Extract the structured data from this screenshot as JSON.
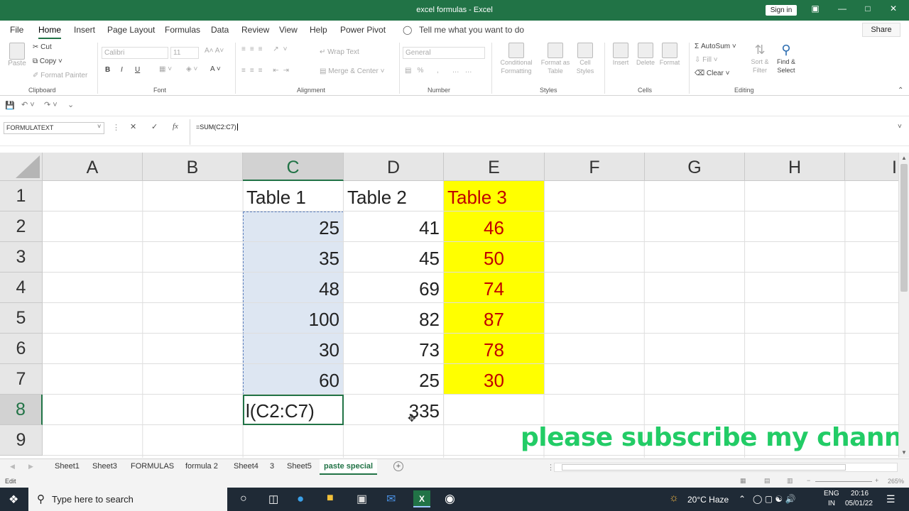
{
  "window": {
    "title": "excel formulas  -  Excel",
    "signin": "Sign in"
  },
  "tabs": [
    "File",
    "Home",
    "Insert",
    "Page Layout",
    "Formulas",
    "Data",
    "Review",
    "View",
    "Help",
    "Power Pivot"
  ],
  "tell_me": "Tell me what you want to do",
  "share": "Share",
  "ribbon": {
    "clipboard": {
      "label": "Clipboard",
      "paste": "Paste",
      "cut": "Cut",
      "copy": "Copy",
      "painter": "Format Painter"
    },
    "font": {
      "label": "Font",
      "name": "Calibri",
      "size": "11"
    },
    "alignment": {
      "label": "Alignment",
      "wrap": "Wrap Text",
      "merge": "Merge & Center"
    },
    "number": {
      "label": "Number",
      "format": "General"
    },
    "styles": {
      "label": "Styles",
      "cond": "Conditional Formatting",
      "table": "Format as Table",
      "cellstyles": "Cell Styles"
    },
    "cells": {
      "label": "Cells",
      "insert": "Insert",
      "delete": "Delete",
      "format": "Format"
    },
    "editing": {
      "label": "Editing",
      "autosum": "AutoSum",
      "fill": "Fill",
      "clear": "Clear",
      "sort": "Sort & Filter",
      "find": "Find & Select"
    }
  },
  "namebox": "FORMULATEXT",
  "formula": "=SUM(C2:C7)",
  "columns": [
    "A",
    "B",
    "C",
    "D",
    "E",
    "F",
    "G",
    "H",
    "I"
  ],
  "rows": [
    "1",
    "2",
    "3",
    "4",
    "5",
    "6",
    "7",
    "8",
    "9"
  ],
  "cells": {
    "c1": "Table 1",
    "d1": "Table 2",
    "e1": "Table 3",
    "c": [
      "25",
      "35",
      "48",
      "100",
      "30",
      "60"
    ],
    "d": [
      "41",
      "45",
      "69",
      "82",
      "73",
      "25"
    ],
    "e": [
      "46",
      "50",
      "74",
      "87",
      "78",
      "30"
    ],
    "c8": "l(C2:C7)",
    "d8": "335"
  },
  "colors": {
    "excel_green": "#217346",
    "yellow": "#ffff00",
    "red_text": "#c00000",
    "subscribe": "#22cc66"
  },
  "overlay": "please subscribe my channel",
  "sheets": [
    "Sheet1",
    "Sheet3",
    "FORMULAS",
    "formula 2",
    "Sheet4",
    "3",
    "Sheet5",
    "paste special"
  ],
  "status": {
    "mode": "Edit",
    "zoom": "265%"
  },
  "taskbar": {
    "search": "Type here to search",
    "weather": "20°C  Haze",
    "lang1": "ENG",
    "lang2": "IN",
    "time": "20:16",
    "date": "05/01/22"
  }
}
